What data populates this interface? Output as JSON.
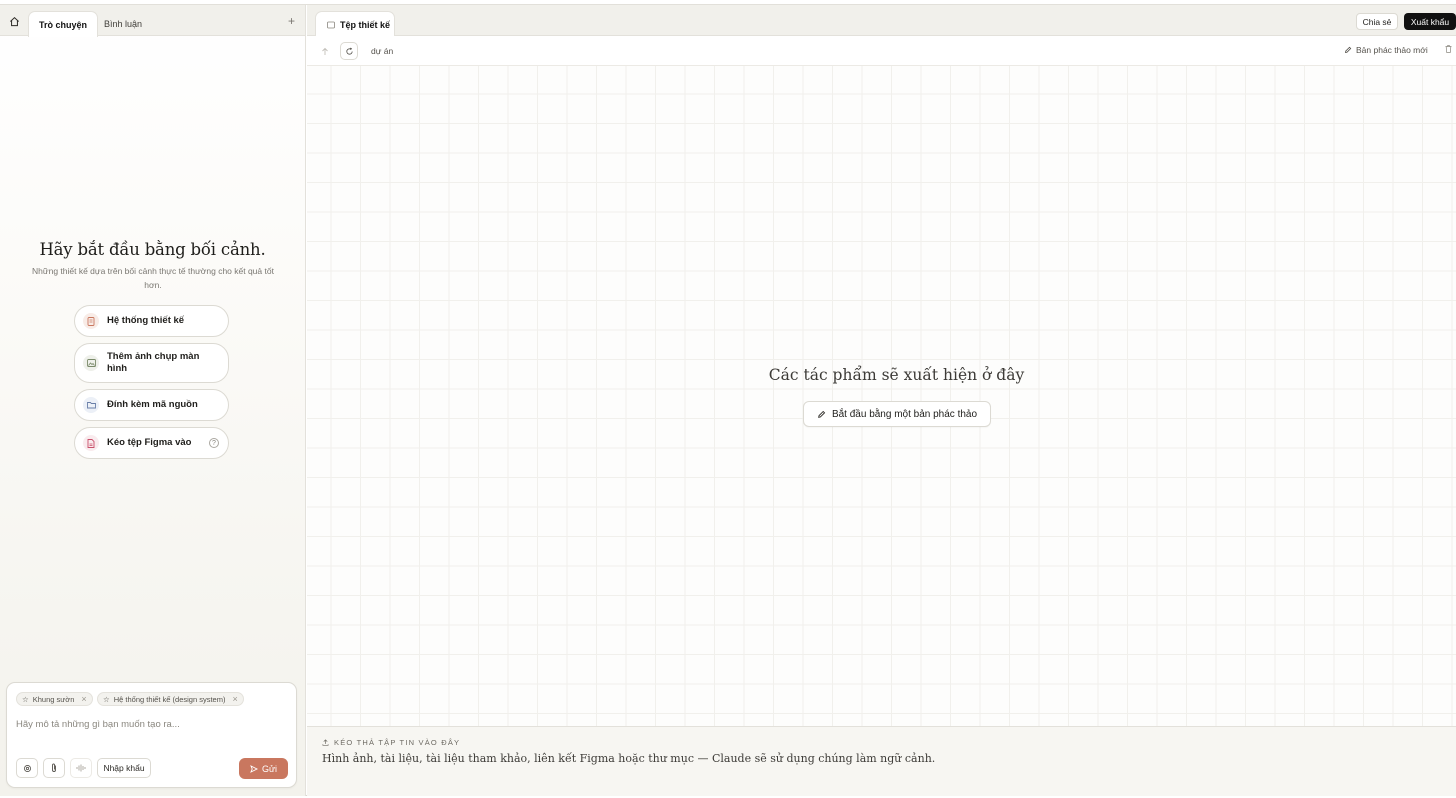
{
  "left_tabs": {
    "chat": "Trò chuyện",
    "comments": "Bình luận",
    "add": "+"
  },
  "hero": {
    "title": "Hãy bắt đầu bằng bối cảnh.",
    "subtitle": "Những thiết kế dựa trên bối cảnh thực tế thường cho kết quả tốt hơn."
  },
  "context_options": [
    {
      "label": "Hệ thống thiết kế",
      "icon": "document-icon",
      "color": "#c9775f"
    },
    {
      "label": "Thêm ảnh chụp màn hình",
      "icon": "image-icon",
      "color": "#7a8a6a"
    },
    {
      "label": "Đính kèm mã nguồn",
      "icon": "folder-icon",
      "color": "#6a7fa8"
    },
    {
      "label": "Kéo tệp Figma vào",
      "icon": "file-icon",
      "color": "#c9506b",
      "help": "?"
    }
  ],
  "composer": {
    "chips": [
      {
        "label": "Khung sườn"
      },
      {
        "label": "Hệ thống thiết kế (design system)"
      }
    ],
    "placeholder": "Hãy mô tả những gì bạn muốn tạo ra...",
    "import_label": "Nhập khẩu",
    "send_label": "Gửi"
  },
  "right_tabs": {
    "design_files": "Tệp thiết kế",
    "share": "Chia sẻ",
    "export": "Xuất khẩu"
  },
  "toolbar": {
    "breadcrumb": "dự án",
    "new_draft": "Bản phác thảo mới"
  },
  "canvas": {
    "empty_title": "Các tác phẩm sẽ xuất hiện ở đây",
    "start_label": "Bắt đầu bằng một bản phác thảo"
  },
  "dropzone": {
    "heading": "KÉO THẢ TẬP TIN VÀO ĐÂY",
    "text": "Hình ảnh, tài liệu, tài liệu tham khảo, liên kết Figma hoặc thư mục — Claude sẽ sử dụng chúng làm ngữ cảnh."
  },
  "colors": {
    "accent": "#c9775f",
    "export_bg": "#111111"
  }
}
